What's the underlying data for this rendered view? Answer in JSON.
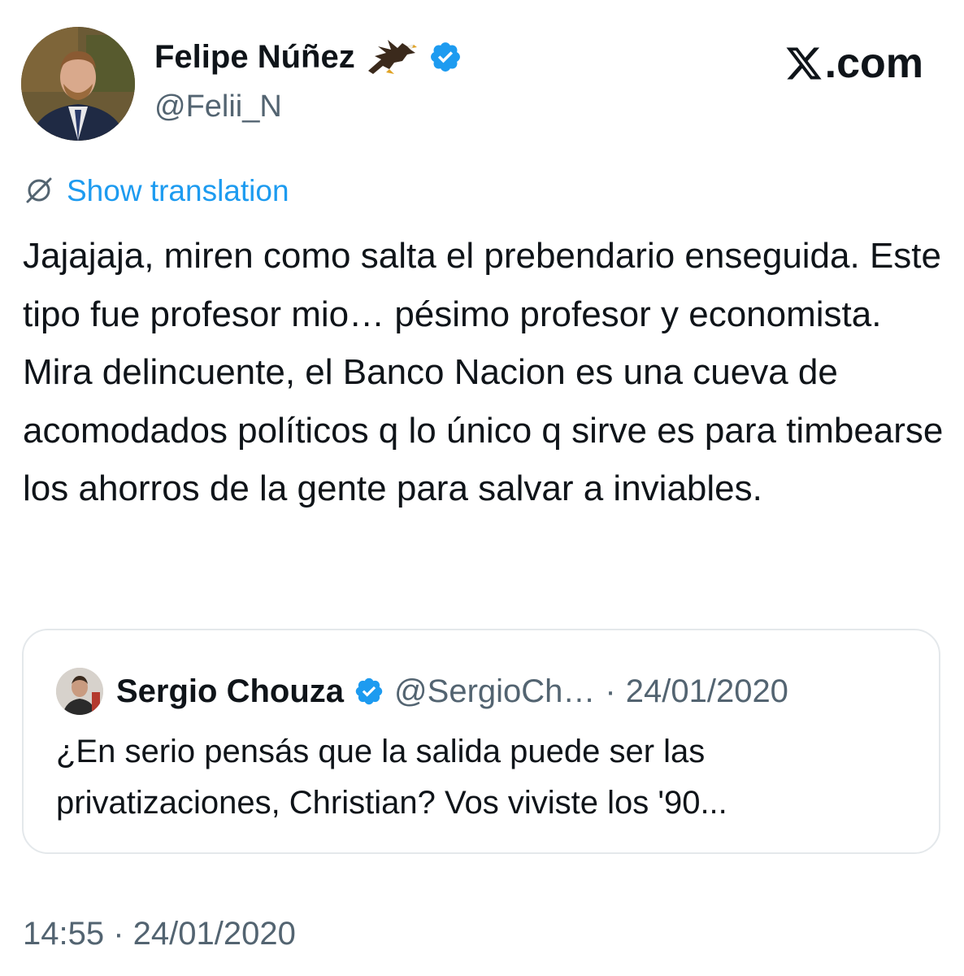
{
  "author": {
    "name": "Felipe Núñez",
    "handle": "@Felii_N",
    "emoji_icon": "eagle-icon",
    "verified": true
  },
  "brand": {
    "logo_icon": "x-logo-icon",
    "suffix": ".com"
  },
  "translation": {
    "label": "Show translation",
    "icon": "translate-icon"
  },
  "tweet": {
    "text": "Jajajaja, miren como salta el prebendario enseguida. Este tipo fue profesor mio… pésimo profesor y economista. Mira delincuente, el Banco Nacion es una cueva de acomodados políticos q lo único q sirve es para timbearse los ahorros de la gente para salvar a inviables.",
    "timestamp": "14:55 · 24/01/2020"
  },
  "quoted_tweet": {
    "author_name": "Sergio Chouza",
    "handle": "@SergioCh…",
    "separator": "·",
    "date": "24/01/2020",
    "verified": true,
    "text": "¿En serio pensás que la salida puede ser las privatizaciones, Christian? Vos viviste los '90..."
  },
  "colors": {
    "text_primary": "#0f1419",
    "text_secondary": "#536471",
    "link": "#1d9bf0",
    "verified": "#1d9bf0",
    "border": "#e4e8eb"
  }
}
